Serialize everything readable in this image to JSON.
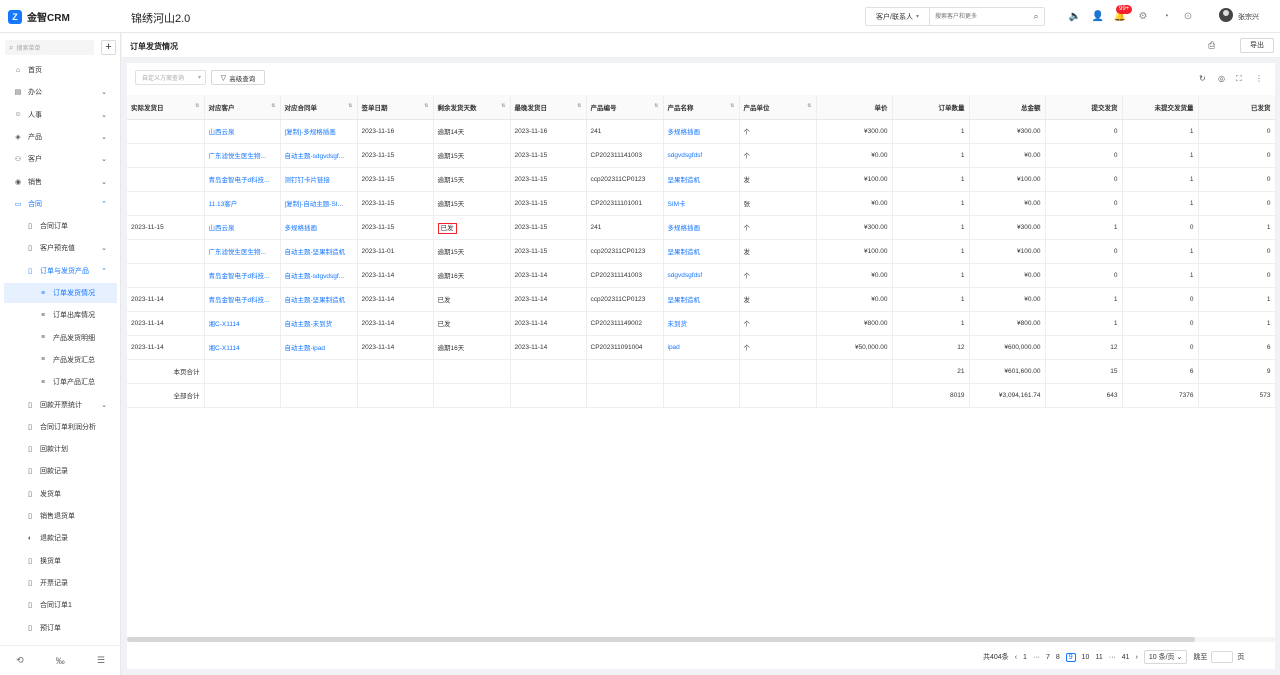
{
  "app": {
    "logo_text": "金智CRM",
    "title": "锦绣河山2.0"
  },
  "topbar": {
    "search_type": "客户/联系人",
    "search_placeholder": "搜索客户和更多",
    "badge": "99+",
    "username": "张宗兴"
  },
  "sidebar": {
    "search_placeholder": "搜索菜单",
    "items": [
      {
        "label": "首页",
        "icon": "home-icon",
        "level": 1
      },
      {
        "label": "办公",
        "icon": "office-icon",
        "level": 1,
        "chevron": "down"
      },
      {
        "label": "人事",
        "icon": "person-icon",
        "level": 1,
        "chevron": "down"
      },
      {
        "label": "产品",
        "icon": "box-icon",
        "level": 1,
        "chevron": "down"
      },
      {
        "label": "客户",
        "icon": "customer-icon",
        "level": 1,
        "chevron": "down"
      },
      {
        "label": "销售",
        "icon": "sales-icon",
        "level": 1,
        "chevron": "down"
      },
      {
        "label": "合同",
        "icon": "contract-icon",
        "level": 1,
        "chevron": "up",
        "active": true
      },
      {
        "label": "合同订单",
        "icon": "doc-icon",
        "level": 2
      },
      {
        "label": "客户预充值",
        "icon": "doc-icon",
        "level": 2,
        "chevron": "down"
      },
      {
        "label": "订单与发货产品",
        "icon": "doc-icon",
        "level": 2,
        "chevron": "up",
        "active": true
      },
      {
        "label": "订单发货情况",
        "icon": "list-icon",
        "level": 3,
        "selected": true
      },
      {
        "label": "订单出库情况",
        "icon": "list-icon",
        "level": 3
      },
      {
        "label": "产品发货明细",
        "icon": "list-icon",
        "level": 3
      },
      {
        "label": "产品发货汇总",
        "icon": "list-icon",
        "level": 3
      },
      {
        "label": "订单产品汇总",
        "icon": "list-icon",
        "level": 3
      },
      {
        "label": "回款开票统计",
        "icon": "doc-icon",
        "level": 2,
        "chevron": "down"
      },
      {
        "label": "合同订单利润分析",
        "icon": "doc-icon",
        "level": 2
      },
      {
        "label": "回款计划",
        "icon": "doc-icon",
        "level": 2
      },
      {
        "label": "回款记录",
        "icon": "doc-icon",
        "level": 2
      },
      {
        "label": "发货单",
        "icon": "doc-icon",
        "level": 2
      },
      {
        "label": "销售退货单",
        "icon": "doc-icon",
        "level": 2
      },
      {
        "label": "退款记录",
        "icon": "refund-icon",
        "level": 2
      },
      {
        "label": "换货单",
        "icon": "doc-icon",
        "level": 2
      },
      {
        "label": "开票记录",
        "icon": "doc-icon",
        "level": 2
      },
      {
        "label": "合同订单1",
        "icon": "doc-icon",
        "level": 2
      },
      {
        "label": "预订单",
        "icon": "doc-icon",
        "level": 2
      }
    ]
  },
  "page": {
    "title": "订单发货情况",
    "export_label": "导出"
  },
  "toolbar": {
    "custom_query_placeholder": "自定义方案查询",
    "advanced_query_label": "高级查询"
  },
  "table": {
    "columns": [
      "实际发货日",
      "对应客户",
      "对应合同单",
      "签单日期",
      "剩余发货天数",
      "最晚发货日",
      "产品编号",
      "产品名称",
      "产品单位",
      "单价",
      "订单数量",
      "总金额",
      "提交发货",
      "未提交发货量",
      "已发货"
    ],
    "rows": [
      [
        "",
        "山西云泉",
        "[复制]-多规格插画",
        "2023-11-16",
        "逾期14天",
        "2023-11-16",
        "241",
        "多规格插画",
        "个",
        "¥300.00",
        "1",
        "¥300.00",
        "0",
        "1",
        "0"
      ],
      [
        "",
        "广东滤悦生医生物...",
        "自动主题-sdgvdsgf...",
        "2023-11-15",
        "逾期15天",
        "2023-11-15",
        "CP202311141003",
        "sdgvdsgfdsf",
        "个",
        "¥0.00",
        "1",
        "¥0.00",
        "0",
        "1",
        "0"
      ],
      [
        "",
        "青岛金智电子d科技...",
        "测钉钉卡片链接",
        "2023-11-15",
        "逾期15天",
        "2023-11-15",
        "ccp202311CP0123",
        "坚果制造机",
        "发",
        "¥100.00",
        "1",
        "¥100.00",
        "0",
        "1",
        "0"
      ],
      [
        "",
        "11.13客户",
        "[复制]-自动主题-SI...",
        "2023-11-15",
        "逾期15天",
        "2023-11-15",
        "CP202311101001",
        "SIM卡",
        "张",
        "¥0.00",
        "1",
        "¥0.00",
        "0",
        "1",
        "0"
      ],
      [
        "2023-11-15",
        "山西云泉",
        "多规格插画",
        "2023-11-15",
        "已发",
        "2023-11-15",
        "241",
        "多规格插画",
        "个",
        "¥300.00",
        "1",
        "¥300.00",
        "1",
        "0",
        "1"
      ],
      [
        "",
        "广东滤悦生医生物...",
        "自动主题-坚果制造机",
        "2023-11-01",
        "逾期15天",
        "2023-11-15",
        "ccp202311CP0123",
        "坚果制造机",
        "发",
        "¥100.00",
        "1",
        "¥100.00",
        "0",
        "1",
        "0"
      ],
      [
        "",
        "青岛金智电子d科技...",
        "自动主题-sdgvdsgf...",
        "2023-11-14",
        "逾期16天",
        "2023-11-14",
        "CP202311141003",
        "sdgvdsgfdsf",
        "个",
        "¥0.00",
        "1",
        "¥0.00",
        "0",
        "1",
        "0"
      ],
      [
        "2023-11-14",
        "青岛金智电子d科技...",
        "自动主题-坚果制造机",
        "2023-11-14",
        "已发",
        "2023-11-14",
        "ccp202311CP0123",
        "坚果制造机",
        "发",
        "¥0.00",
        "1",
        "¥0.00",
        "1",
        "0",
        "1"
      ],
      [
        "2023-11-14",
        "湘C-X1114",
        "自动主题-未到货",
        "2023-11-14",
        "已发",
        "2023-11-14",
        "CP202311149002",
        "未到货",
        "个",
        "¥800.00",
        "1",
        "¥800.00",
        "1",
        "0",
        "1"
      ],
      [
        "2023-11-14",
        "湘C-X1114",
        "自动主题-ipad",
        "2023-11-14",
        "逾期16天",
        "2023-11-14",
        "CP202311091004",
        "ipad",
        "个",
        "¥50,000.00",
        "12",
        "¥600,000.00",
        "12",
        "0",
        "6"
      ]
    ],
    "boxed_cell": {
      "row": 4,
      "col": 4
    },
    "page_total": {
      "label": "本页合计",
      "qty": "21",
      "amount": "¥601,600.00",
      "submitted": "15",
      "unsubmitted": "6",
      "shipped": "9"
    },
    "all_total": {
      "label": "全部合计",
      "qty": "8019",
      "amount": "¥3,094,161.74",
      "submitted": "643",
      "unsubmitted": "7376",
      "shipped": "573"
    }
  },
  "pagination": {
    "total": "共404条",
    "pages": [
      "1",
      "···",
      "7",
      "8",
      "9",
      "10",
      "11",
      "···",
      "41"
    ],
    "current": "9",
    "page_size": "10 条/页",
    "jump_label": "跳至",
    "page_suffix": "页"
  }
}
